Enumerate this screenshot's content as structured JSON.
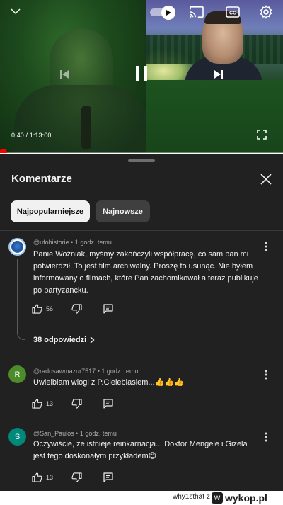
{
  "player": {
    "time": "0:40 / 1:13:00",
    "progress_fraction": 0.009,
    "icons": {
      "collapse": "chevron-down-icon",
      "autoplay": "autoplay-toggle",
      "cast": "cast-icon",
      "captions": "cc-icon",
      "settings": "gear-icon",
      "previous": "previous-icon",
      "pause": "pause-icon",
      "next": "next-icon",
      "fullscreen": "fullscreen-icon"
    },
    "colors": {
      "progress": "#ff0000"
    }
  },
  "comments_panel": {
    "title": "Komentarze",
    "close_icon": "close-icon",
    "filters": [
      {
        "label": "Najpopularniejsze",
        "selected": true
      },
      {
        "label": "Najnowsze",
        "selected": false
      }
    ],
    "comments": [
      {
        "avatar_letter": "",
        "author": "@ufohistorie",
        "time": "1 godz. temu",
        "meta": "@ufohistorie • 1 godz. temu",
        "text": "Panie Woźniak, myśmy zakończyli współpracę, co sam pan mi potwierdził. To jest film archiwalny. Proszę to usunąć. Nie byłem informowany o filmach, które Pan zachomikował a teraz publikuje po partyzancku.",
        "likes": "56",
        "replies_label": "38 odpowiedzi"
      },
      {
        "avatar_letter": "R",
        "avatar_color": "#4c8c2b",
        "author": "@radosawmazur7517",
        "time": "1 godz. temu",
        "meta": "@radosawmazur7517 • 1 godz. temu",
        "text": "Uwielbiam wlogi z P.Cielebiasiem...👍👍👍",
        "likes": "13"
      },
      {
        "avatar_letter": "S",
        "avatar_color": "#00897b",
        "author": "@San_Paulos",
        "time": "1 godz. temu",
        "meta": "@San_Paulos • 1 godz. temu",
        "text": "Oczywiście, że istnieje reinkarnacja... Doktor Mengele i Gizela jest tego doskonałym przykładem😊",
        "likes": "13"
      }
    ]
  },
  "watermark": {
    "username": "why1sthat",
    "suffix": "z",
    "brand": "wykop.pl"
  }
}
